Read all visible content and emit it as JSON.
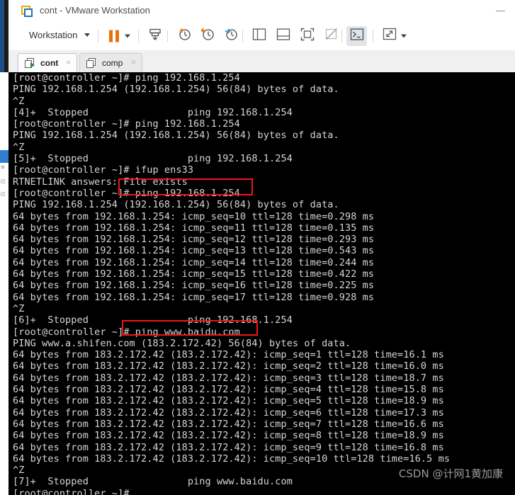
{
  "window": {
    "title": "cont - VMware Workstation",
    "app_icon": "vmware-icon",
    "minimize_label": "Minimize"
  },
  "toolbar": {
    "workstation_menu": "Workstation",
    "items": [
      {
        "name": "workstation-menu",
        "label": "Workstation",
        "icon": "chevron-down-icon"
      },
      {
        "name": "suspend-button",
        "label": "",
        "icon": "pause-icon"
      },
      {
        "name": "suspend-dropdown",
        "label": "",
        "icon": "chevron-down-icon"
      },
      {
        "name": "power-button",
        "label": "",
        "icon": "power-down-icon"
      },
      {
        "name": "snapshot-take-button",
        "label": "",
        "icon": "snapshot-add-icon"
      },
      {
        "name": "snapshot-revert-button",
        "label": "",
        "icon": "snapshot-revert-icon"
      },
      {
        "name": "snapshot-manager-button",
        "label": "",
        "icon": "snapshot-manager-icon"
      },
      {
        "name": "show-library-button",
        "label": "",
        "icon": "panel-left-icon"
      },
      {
        "name": "show-thumbnails-button",
        "label": "",
        "icon": "panel-bottom-icon"
      },
      {
        "name": "fullscreen-button",
        "label": "",
        "icon": "fullscreen-icon"
      },
      {
        "name": "unity-button",
        "label": "",
        "icon": "unity-icon"
      },
      {
        "name": "console-view-button",
        "label": "",
        "icon": "terminal-prompt-icon"
      },
      {
        "name": "stretch-button",
        "label": "",
        "icon": "stretch-arrows-icon"
      },
      {
        "name": "stretch-dropdown",
        "label": "",
        "icon": "chevron-down-icon"
      }
    ]
  },
  "tabs": [
    {
      "label": "cont",
      "active": true,
      "icon": "vm-running-icon",
      "close": "×"
    },
    {
      "label": "comp",
      "active": false,
      "icon": "vm-stopped-icon",
      "close": "×"
    }
  ],
  "terminal": {
    "prompt": "[root@controller ~]#",
    "cursor": "_",
    "lines": [
      "[root@controller ~]# ping 192.168.1.254",
      "PING 192.168.1.254 (192.168.1.254) 56(84) bytes of data.",
      "^Z",
      "[4]+  Stopped                 ping 192.168.1.254",
      "[root@controller ~]# ping 192.168.1.254",
      "PING 192.168.1.254 (192.168.1.254) 56(84) bytes of data.",
      "^Z",
      "[5]+  Stopped                 ping 192.168.1.254",
      "[root@controller ~]# ifup ens33",
      "RTNETLINK answers: File exists",
      "[root@controller ~]# ping 192.168.1.254",
      "PING 192.168.1.254 (192.168.1.254) 56(84) bytes of data.",
      "64 bytes from 192.168.1.254: icmp_seq=10 ttl=128 time=0.298 ms",
      "64 bytes from 192.168.1.254: icmp_seq=11 ttl=128 time=0.135 ms",
      "64 bytes from 192.168.1.254: icmp_seq=12 ttl=128 time=0.293 ms",
      "64 bytes from 192.168.1.254: icmp_seq=13 ttl=128 time=0.543 ms",
      "64 bytes from 192.168.1.254: icmp_seq=14 ttl=128 time=0.244 ms",
      "64 bytes from 192.168.1.254: icmp_seq=15 ttl=128 time=0.422 ms",
      "64 bytes from 192.168.1.254: icmp_seq=16 ttl=128 time=0.225 ms",
      "64 bytes from 192.168.1.254: icmp_seq=17 ttl=128 time=0.928 ms",
      "^Z",
      "[6]+  Stopped                 ping 192.168.1.254",
      "[root@controller ~]# ping www.baidu.com",
      "PING www.a.shifen.com (183.2.172.42) 56(84) bytes of data.",
      "64 bytes from 183.2.172.42 (183.2.172.42): icmp_seq=1 ttl=128 time=16.1 ms",
      "64 bytes from 183.2.172.42 (183.2.172.42): icmp_seq=2 ttl=128 time=16.0 ms",
      "64 bytes from 183.2.172.42 (183.2.172.42): icmp_seq=3 ttl=128 time=18.7 ms",
      "64 bytes from 183.2.172.42 (183.2.172.42): icmp_seq=4 ttl=128 time=15.8 ms",
      "64 bytes from 183.2.172.42 (183.2.172.42): icmp_seq=5 ttl=128 time=18.9 ms",
      "64 bytes from 183.2.172.42 (183.2.172.42): icmp_seq=6 ttl=128 time=17.3 ms",
      "64 bytes from 183.2.172.42 (183.2.172.42): icmp_seq=7 ttl=128 time=16.6 ms",
      "64 bytes from 183.2.172.42 (183.2.172.42): icmp_seq=8 ttl=128 time=18.9 ms",
      "64 bytes from 183.2.172.42 (183.2.172.42): icmp_seq=9 ttl=128 time=16.8 ms",
      "64 bytes from 183.2.172.42 (183.2.172.42): icmp_seq=10 ttl=128 time=16.5 ms",
      "^Z",
      "[7]+  Stopped                 ping www.baidu.com",
      "[root@controller ~]# _"
    ]
  },
  "annotations": {
    "color": "#f01515",
    "boxes": [
      {
        "name": "highlight-ping-gateway",
        "label": "# ping 192.168.1.254"
      },
      {
        "name": "highlight-ping-baidu",
        "label": "]# ping www.baidu.com"
      }
    ]
  },
  "watermark": {
    "text": "CSDN @计网1黄加康"
  }
}
